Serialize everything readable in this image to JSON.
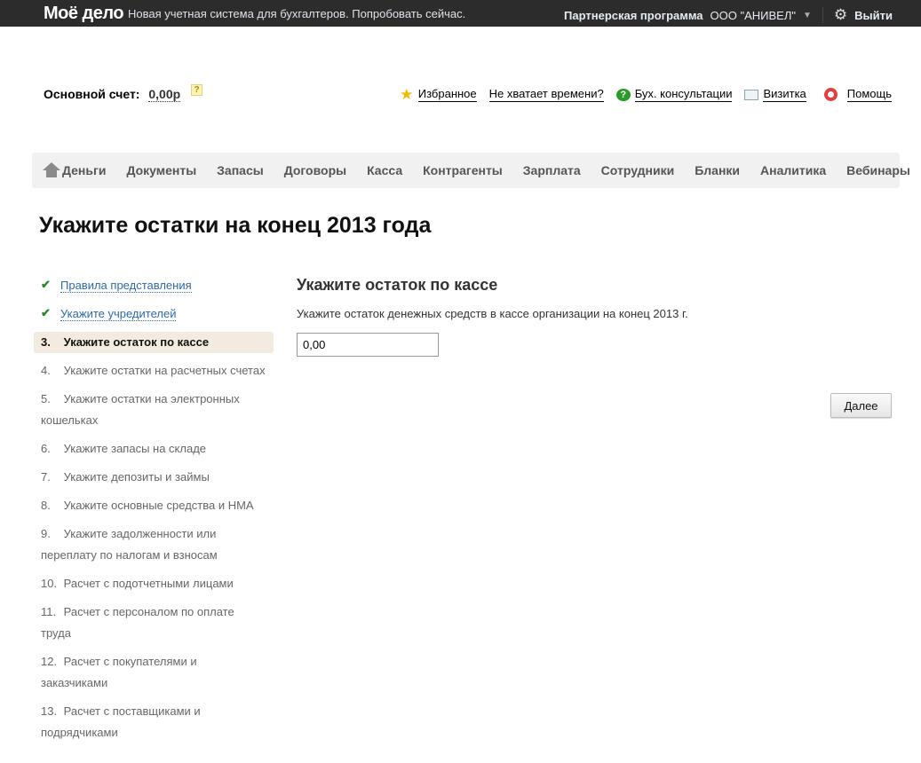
{
  "topbar": {
    "logo": "Моё дело",
    "promo": "Новая учетная система для бухгалтеров. Попробовать сейчас.",
    "partner": "Партнерская программа",
    "org": "ООО \"АНИВЕЛ\"",
    "exit": "Выйти"
  },
  "account": {
    "label": "Основной счет:",
    "value": "0,00р",
    "help": "?"
  },
  "links": {
    "favorites": "Избранное",
    "no_time": "Не хватает времени?",
    "consult": "Бух. консультации",
    "card": "Визитка",
    "help": "Помощь"
  },
  "nav": [
    "Деньги",
    "Документы",
    "Запасы",
    "Договоры",
    "Касса",
    "Контрагенты",
    "Зарплата",
    "Сотрудники",
    "Бланки",
    "Аналитика",
    "Вебинары"
  ],
  "title": "Укажите остатки на конец 2013 года",
  "steps": [
    {
      "n": "",
      "label": "Правила представления",
      "state": "done"
    },
    {
      "n": "",
      "label": "Укажите учредителей",
      "state": "done"
    },
    {
      "n": "3.",
      "label": "Укажите остаток по кассе",
      "state": "current"
    },
    {
      "n": "4.",
      "label": "Укажите остатки на расчетных счетах"
    },
    {
      "n": "5.",
      "label": "Укажите остатки на электронных кошельках"
    },
    {
      "n": "6.",
      "label": "Укажите запасы на складе"
    },
    {
      "n": "7.",
      "label": "Укажите депозиты и займы"
    },
    {
      "n": "8.",
      "label": "Укажите основные средства и НМА"
    },
    {
      "n": "9.",
      "label": "Укажите задолженности или переплату по налогам и взносам"
    },
    {
      "n": "10.",
      "label": "Расчет с подотчетными лицами"
    },
    {
      "n": "11.",
      "label": "Расчет с персоналом по оплате труда"
    },
    {
      "n": "12.",
      "label": "Расчет с покупателями и заказчиками"
    },
    {
      "n": "13.",
      "label": "Расчет с поставщиками и подрядчиками"
    }
  ],
  "main": {
    "heading": "Укажите остаток по кассе",
    "description": "Укажите остаток денежных средств в кассе организации на конец 2013 г.",
    "value": "0,00",
    "next": "Далее"
  }
}
